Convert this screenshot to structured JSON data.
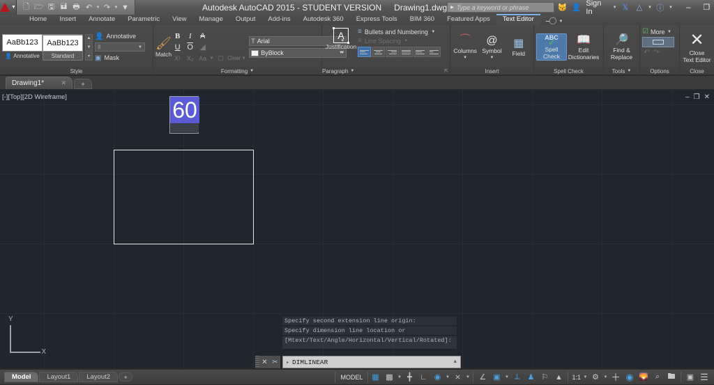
{
  "titlebar": {
    "app_menu_icon": "autocad-logo-icon",
    "quick_access": [
      {
        "name": "new-file-icon",
        "glyph": "❐"
      },
      {
        "name": "open-folder-icon",
        "glyph": "◱"
      },
      {
        "name": "save-icon",
        "glyph": "▣"
      },
      {
        "name": "save-as-icon",
        "glyph": "▤"
      },
      {
        "name": "plot-print-icon",
        "glyph": "⎙"
      },
      {
        "name": "undo-icon",
        "glyph": "↶"
      },
      {
        "name": "redo-icon",
        "glyph": "↷"
      },
      {
        "name": "qat-dropdown-icon",
        "glyph": "▼"
      }
    ],
    "title": "Autodesk AutoCAD 2015 - STUDENT VERSION",
    "document": "Drawing1.dwg",
    "search_placeholder": "Type a keyword or phrase",
    "search_icon": "binoculars-icon",
    "sign_in": "Sign In",
    "exchange_icon": "autodesk-exchange-icon",
    "share_icon": "share-icon",
    "help_icon": "help-icon",
    "window_minimize": "–",
    "window_restore": "❐",
    "window_close": "✕"
  },
  "ribbon_tabs": {
    "items": [
      "Home",
      "Insert",
      "Annotate",
      "Parametric",
      "View",
      "Manage",
      "Output",
      "Add-ins",
      "Autodesk 360",
      "Express Tools",
      "BIM 360",
      "Featured Apps",
      "Text Editor"
    ],
    "active": "Text Editor"
  },
  "panels": {
    "style": {
      "title": "Style",
      "preview_text": "AaBb123",
      "style_annotative_label": "Annotative",
      "style_standard_label": "Standard",
      "annotative_toggle_label": "Annotative",
      "text_height_value": "8",
      "mask_label": "Mask"
    },
    "formatting": {
      "title": "Formatting",
      "match_label": "Match",
      "bold": "B",
      "italic": "I",
      "strike": "A",
      "underline": "U",
      "overline": "O",
      "stack": "⚫",
      "superscript": "X¹",
      "subscript": "X₂",
      "case_label": "Aa",
      "clear_label": "Clear",
      "font_value": "Arial",
      "color_value": "ByBlock"
    },
    "paragraph": {
      "title": "Paragraph",
      "justification_label": "Justification",
      "bullets_label": "Bullets and Numbering",
      "linespacing_label": "Line Spacing",
      "align_buttons": [
        "align-left",
        "align-center",
        "align-right",
        "align-justify",
        "align-distribute",
        "align-combine"
      ],
      "align_active_index": 0
    },
    "insert": {
      "title": "Insert",
      "columns_label": "Columns",
      "symbol_label": "Symbol",
      "symbol_glyph": "@",
      "field_label": "Field"
    },
    "spell_check": {
      "title": "Spell Check",
      "spell_check_label_line1": "Spell",
      "spell_check_label_line2": "Check",
      "spell_check_badge": "ABC",
      "edit_dict_line1": "Edit",
      "edit_dict_line2": "Dictionaries"
    },
    "tools": {
      "title": "Tools",
      "find_replace_line1": "Find &",
      "find_replace_line2": "Replace"
    },
    "options": {
      "title": "Options",
      "more_label": "More"
    },
    "close": {
      "title": "Close",
      "close_line1": "Close",
      "close_line2": "Text Editor",
      "close_glyph": "✕"
    }
  },
  "file_tabs": {
    "items": [
      {
        "label": "Drawing1*",
        "close": "✕"
      }
    ],
    "add_label": "+"
  },
  "canvas": {
    "viewport_label": "[-][Top][2D Wireframe]",
    "viewport_controls": {
      "minimize": "–",
      "restore": "❐",
      "close": "✕"
    },
    "mtext_value": "60",
    "ucs_y": "Y",
    "ucs_x": "X",
    "background_color": "#20262e",
    "geometry_color": "#e8e8e8",
    "selection_color": "#5b5bd6",
    "command_history": [
      "Specify second extension line origin:",
      "Specify dimension line location or",
      "[Mtext/Text/Angle/Horizontal/Vertical/Rotated]:"
    ]
  },
  "command_line": {
    "close_icon": "✕",
    "customize_icon": "⚒",
    "prompt_arrow": "▸",
    "value": "DIMLINEAR",
    "expand_icon": "▲"
  },
  "status_bar": {
    "layout_tabs": [
      "Model",
      "Layout1",
      "Layout2"
    ],
    "layout_active": "Model",
    "layout_add": "+",
    "model_label": "MODEL",
    "toggles": [
      {
        "name": "grid-display-icon",
        "glyph": "▦",
        "active": true
      },
      {
        "name": "snap-mode-icon",
        "glyph": "░",
        "active": false
      },
      {
        "name": "infer-constraints-icon",
        "glyph": "┿",
        "active": false
      },
      {
        "name": "ortho-mode-icon",
        "glyph": "∟",
        "active": false
      },
      {
        "name": "polar-tracking-icon",
        "glyph": "◔",
        "active": true
      },
      {
        "name": "object-snap-icon",
        "glyph": "✕",
        "active": false
      },
      {
        "name": "3d-object-snap-icon",
        "glyph": "∠",
        "active": false
      },
      {
        "name": "object-snap-tracking-icon",
        "glyph": "◱",
        "active": true
      },
      {
        "name": "allow-ucs-icon",
        "glyph": "⟂",
        "active": false
      },
      {
        "name": "dynamic-input-icon",
        "glyph": "✠",
        "active": true
      },
      {
        "name": "lineweight-icon",
        "glyph": "≣",
        "active": false
      },
      {
        "name": "transparency-icon",
        "glyph": "△",
        "active": false
      }
    ],
    "annotation_scale": "1:1",
    "right_icons": [
      {
        "name": "annotation-visibility-icon",
        "glyph": "⚙"
      },
      {
        "name": "add-scales-icon",
        "glyph": "＋"
      },
      {
        "name": "workspace-switching-icon",
        "glyph": "◉"
      },
      {
        "name": "isolate-objects-icon",
        "glyph": "⛰"
      },
      {
        "name": "hardware-accel-icon",
        "glyph": "⌗"
      },
      {
        "name": "clean-screen-icon",
        "glyph": "❑"
      },
      {
        "name": "display-toolbar-icon",
        "glyph": "▣"
      },
      {
        "name": "customization-menu-icon",
        "glyph": "≡"
      }
    ]
  }
}
